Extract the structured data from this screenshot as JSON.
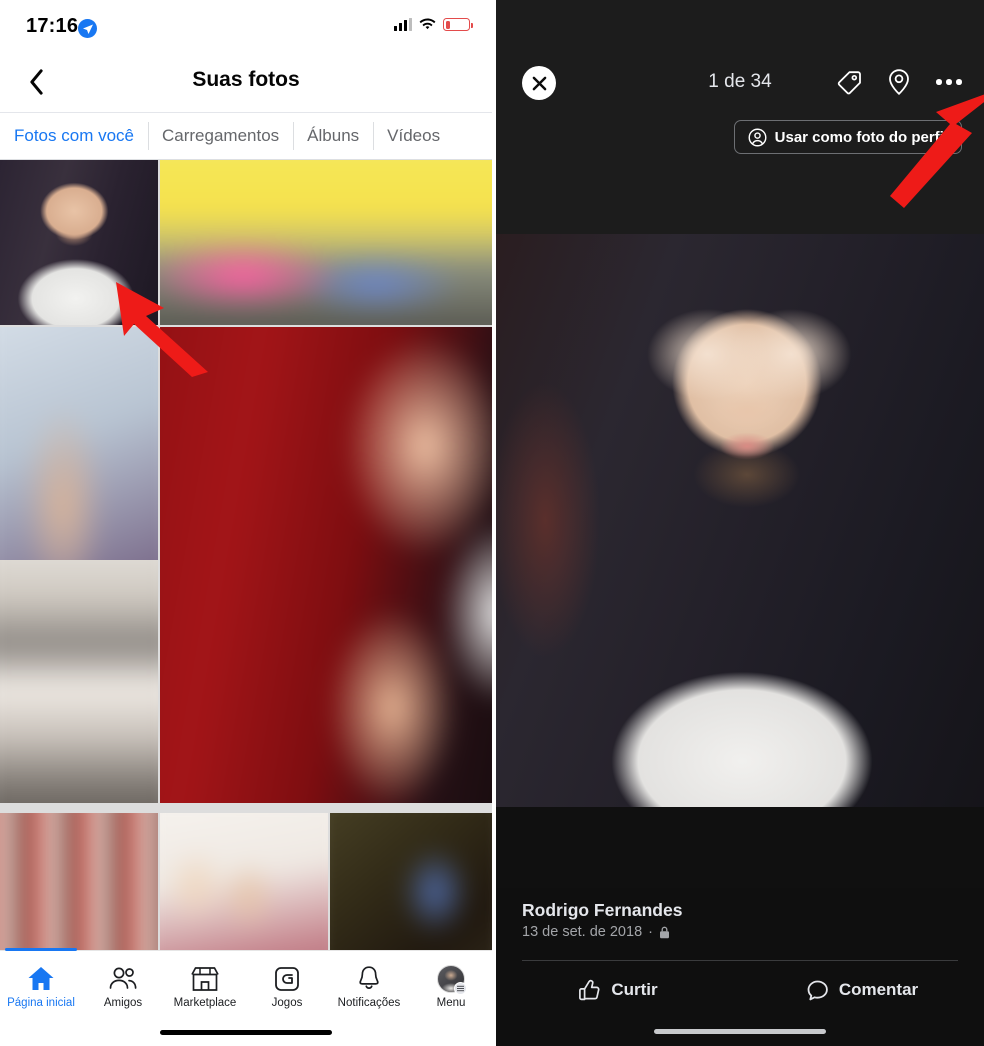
{
  "left": {
    "status": {
      "time": "17:16",
      "location_icon": "location-arrow-icon",
      "signal_icon": "cellular-signal-icon",
      "wifi_icon": "wifi-icon",
      "battery_icon": "battery-low-icon"
    },
    "nav": {
      "back_icon": "chevron-left-icon",
      "title": "Suas fotos"
    },
    "tabs": [
      {
        "label": "Fotos com você",
        "active": true
      },
      {
        "label": "Carregamentos",
        "active": false
      },
      {
        "label": "Álbuns",
        "active": false
      },
      {
        "label": "Vídeos",
        "active": false
      }
    ],
    "bottom_nav": [
      {
        "label": "Página inicial",
        "icon": "home-icon",
        "active": true
      },
      {
        "label": "Amigos",
        "icon": "friends-icon",
        "active": false
      },
      {
        "label": "Marketplace",
        "icon": "marketplace-icon",
        "active": false
      },
      {
        "label": "Jogos",
        "icon": "games-icon",
        "active": false
      },
      {
        "label": "Notificações",
        "icon": "bell-icon",
        "active": false
      },
      {
        "label": "Menu",
        "icon": "avatar-menu-icon",
        "active": false
      }
    ]
  },
  "right": {
    "close_icon": "close-icon",
    "counter": "1 de 34",
    "tag_icon": "tag-icon",
    "location_icon": "location-pin-icon",
    "more_icon": "more-options-icon",
    "use_as_profile": {
      "label": "Usar como foto do perfil",
      "icon": "person-circle-icon"
    },
    "author": "Rodrigo Fernandes",
    "date": "13 de set. de 2018",
    "separator": "·",
    "privacy_icon": "lock-icon",
    "actions": [
      {
        "label": "Curtir",
        "icon": "thumbs-up-icon"
      },
      {
        "label": "Comentar",
        "icon": "comment-icon"
      }
    ]
  },
  "colors": {
    "accent": "#1877f2",
    "arrow": "#ee1b18",
    "dark_bg": "#101010",
    "battery_low": "#e34b4b"
  }
}
